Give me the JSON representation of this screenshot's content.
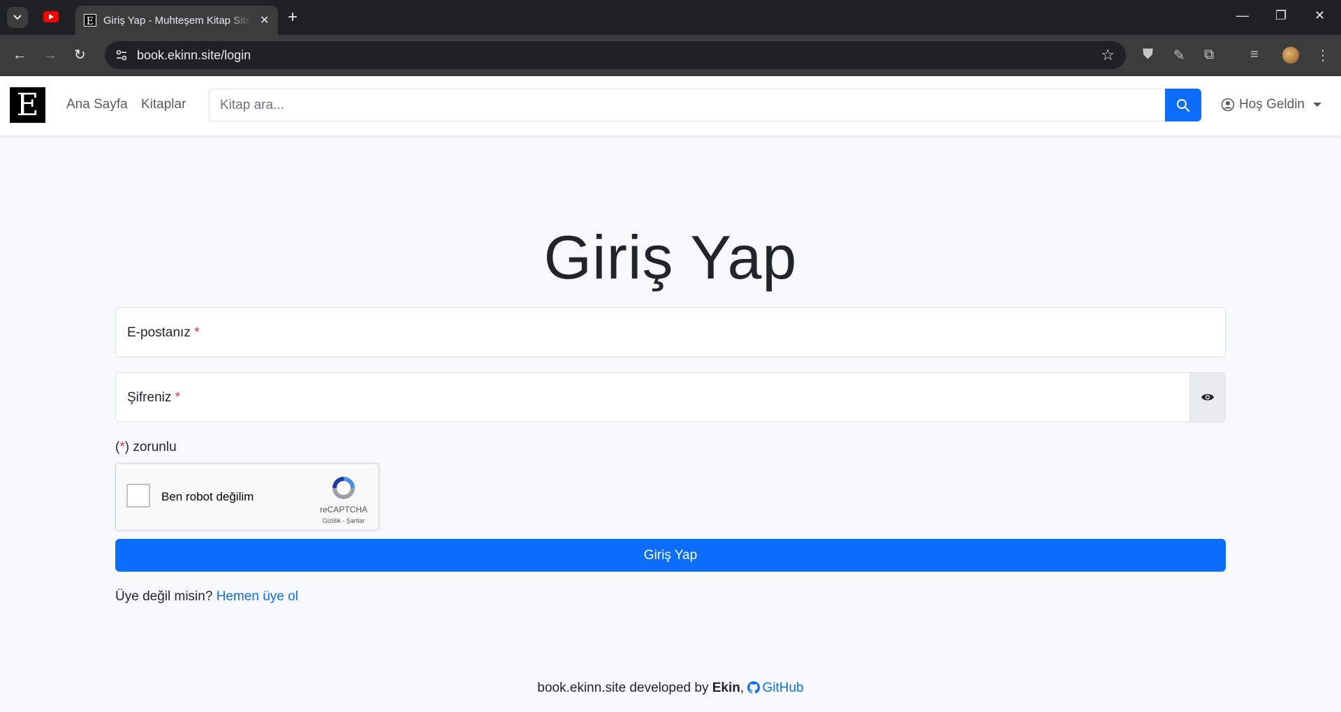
{
  "browser": {
    "tab_title": "Giriş Yap - Muhteşem Kitap Sitesi",
    "tab_favicon_letter": "E",
    "url": "book.ekinn.site/login",
    "icons": {
      "tab_search": "chevron-down-icon",
      "youtube_tab": "youtube-icon",
      "close_tab": "close-icon",
      "new_tab": "plus-icon",
      "back": "arrow-left-icon",
      "forward": "arrow-right-icon",
      "reload": "reload-icon",
      "site_info": "tune-icon",
      "bookmark": "star-icon",
      "extensions": [
        "ublock-icon",
        "eyedropper-icon",
        "puzzle-icon",
        "media-queue-icon"
      ],
      "menu": "kebab-icon"
    }
  },
  "navbar": {
    "brand_letter": "E",
    "links": [
      "Ana Sayfa",
      "Kitaplar"
    ],
    "search_placeholder": "Kitap ara...",
    "user_menu_label": "Hoş Geldin"
  },
  "login": {
    "title": "Giriş Yap",
    "email_label": "E-postanız",
    "password_label": "Şifreniz",
    "required_marker": "*",
    "required_note_open": "(",
    "required_note_close": ") zorunlu",
    "captcha_label": "Ben robot değilim",
    "captcha_brand": "reCAPTCHA",
    "captcha_terms": "Gizlilik - Şartlar",
    "submit_label": "Giriş Yap",
    "signup_prompt": "Üye değil misin?",
    "signup_link": "Hemen üye ol"
  },
  "footer": {
    "site": "book.ekinn.site developed by",
    "author": "Ekin",
    "separator": ",",
    "github_label": "GitHub"
  },
  "colors": {
    "primary": "#0d6efd",
    "required": "#dc3545",
    "page_bg": "#f8f9fa"
  }
}
